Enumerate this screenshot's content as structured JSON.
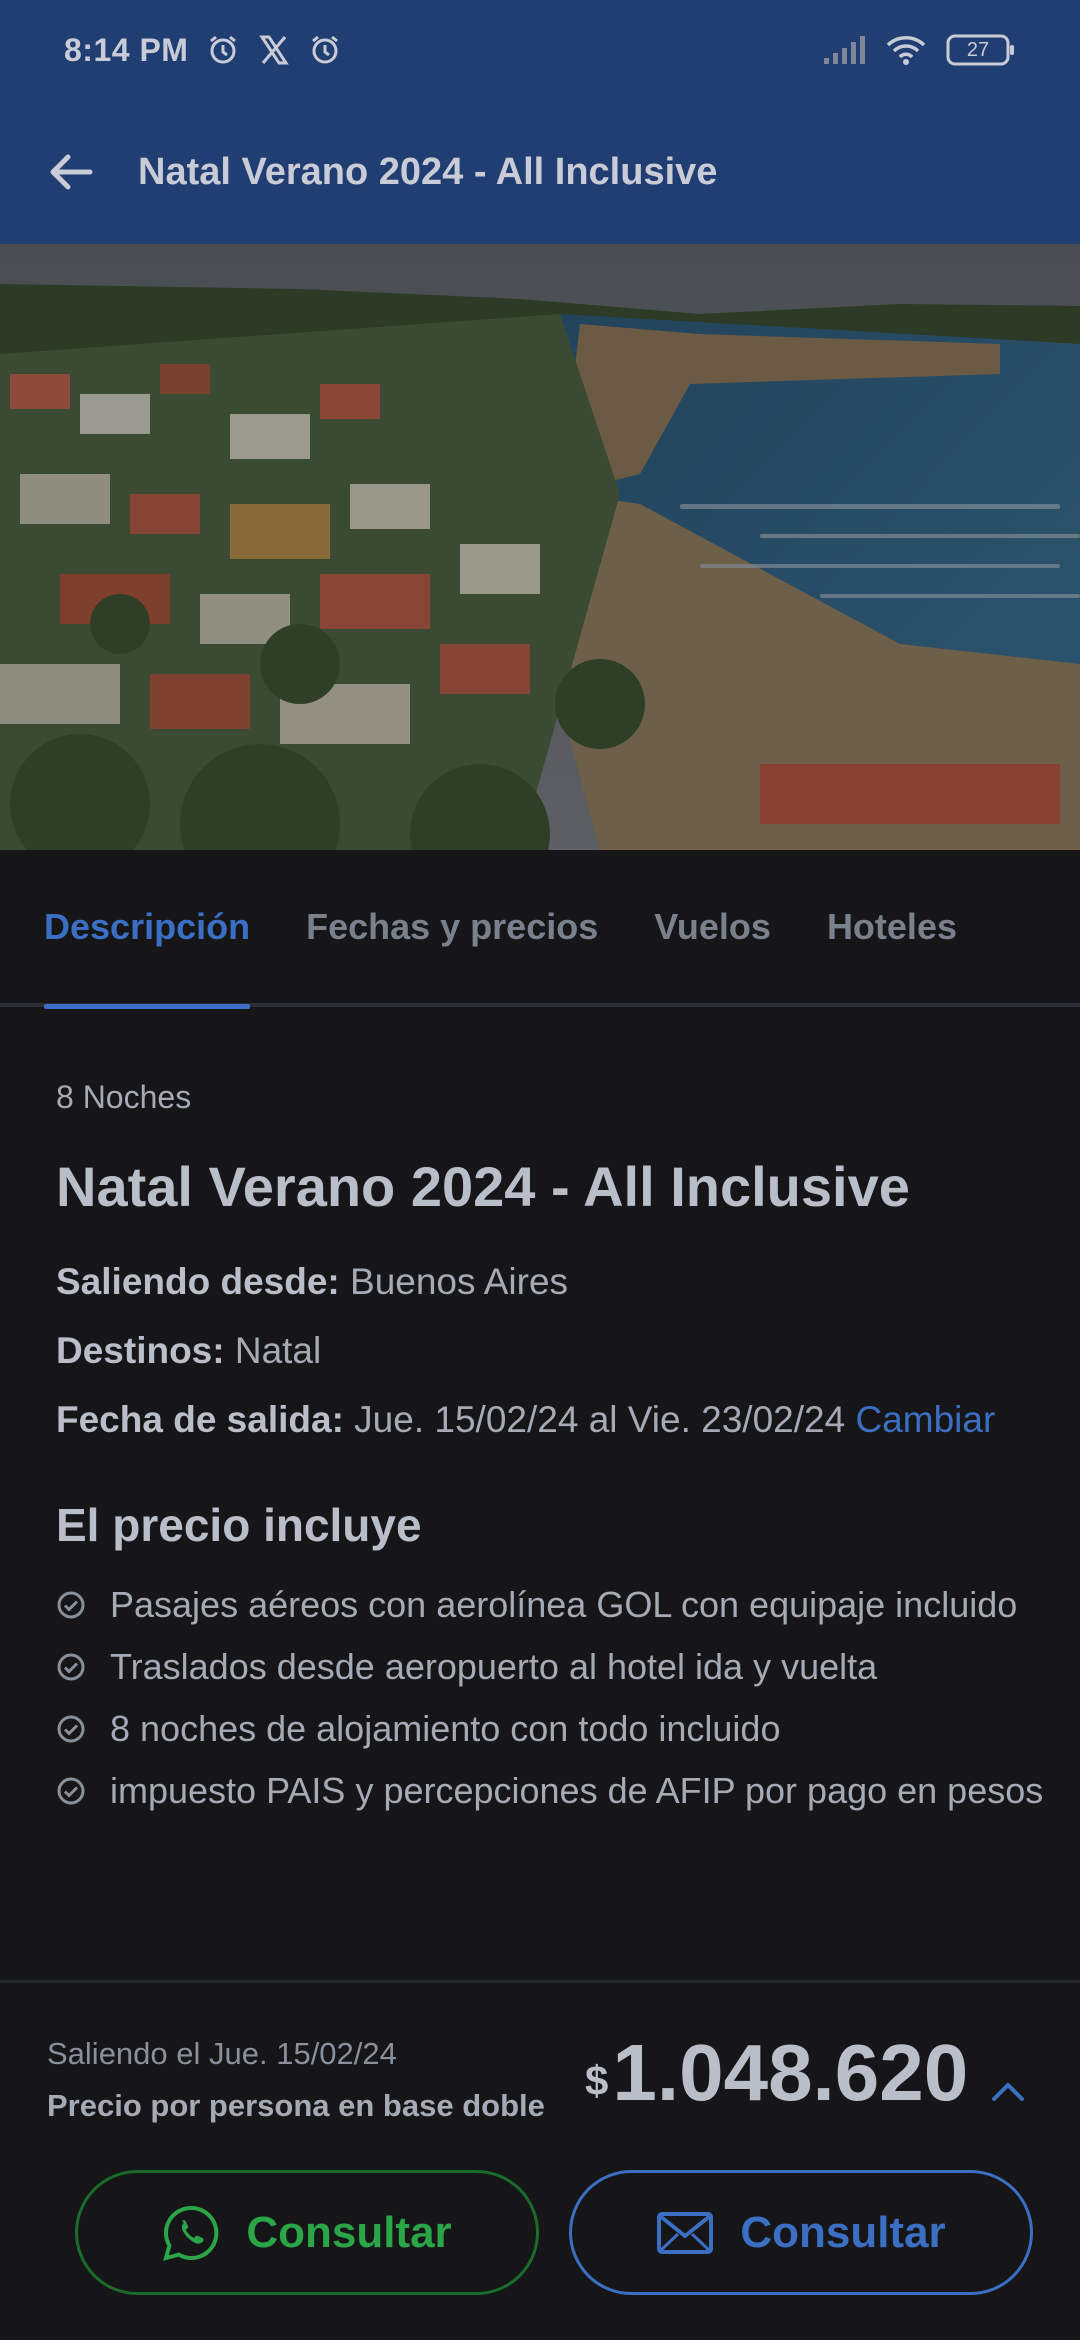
{
  "status_bar": {
    "time": "8:14 PM",
    "battery": "27",
    "icons": [
      "alarm-icon",
      "x-icon",
      "alarm-icon",
      "signal-icon",
      "wifi-icon",
      "battery-icon"
    ]
  },
  "app_bar": {
    "title": "Natal Verano 2024 - All Inclusive",
    "back_icon": "arrow-left-icon"
  },
  "tabs": [
    {
      "label": "Descripción",
      "active": true
    },
    {
      "label": "Fechas y precios",
      "active": false
    },
    {
      "label": "Vuelos",
      "active": false
    },
    {
      "label": "Hoteles",
      "active": false
    }
  ],
  "description": {
    "nights": "8 Noches",
    "title": "Natal Verano 2024 - All Inclusive",
    "departure_from_label": "Saliendo desde:",
    "departure_from_value": "Buenos Aires",
    "destinations_label": "Destinos:",
    "destinations_value": "Natal",
    "departure_date_label": "Fecha de salida:",
    "departure_date_value": "Jue. 15/02/24 al Vie. 23/02/24",
    "change_link": "Cambiar",
    "includes_title": "El precio incluye",
    "includes": [
      "Pasajes aéreos con aerolínea GOL con equipaje incluido",
      "Traslados desde aeropuerto al hotel ida y vuelta",
      "8 noches de alojamiento con todo incluido",
      "impuesto PAIS y percepciones de AFIP por pago en pesos"
    ]
  },
  "footer": {
    "departure": "Saliendo el Jue. 15/02/24",
    "per_person": "Precio por persona en base doble",
    "currency": "$",
    "price": "1.048.620",
    "whatsapp_button": "Consultar",
    "email_button": "Consultar"
  },
  "colors": {
    "header_bg": "#213e73",
    "accent": "#3a6fc4",
    "whatsapp": "#2aa548",
    "background": "#161618"
  }
}
